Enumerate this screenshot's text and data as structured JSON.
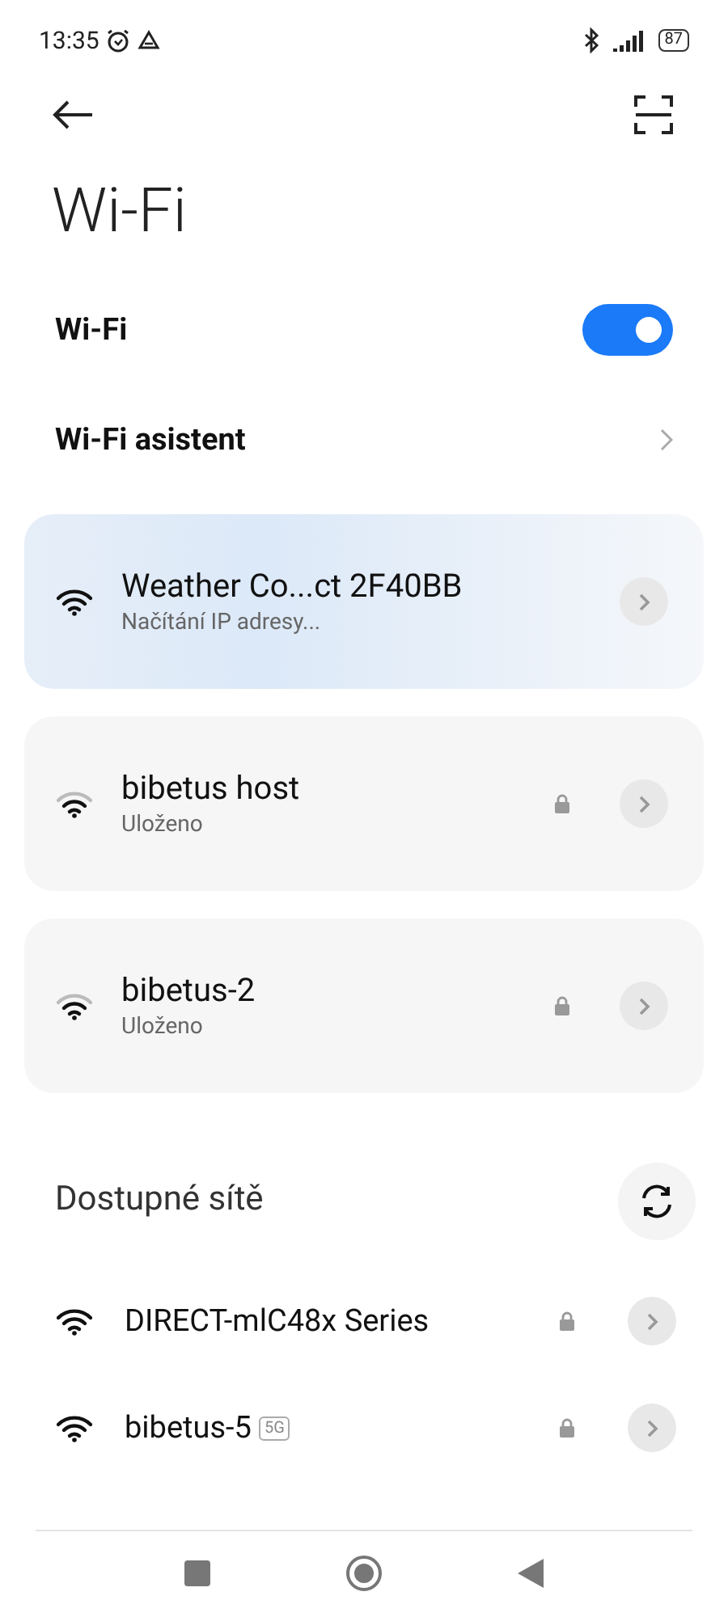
{
  "status_bar": {
    "time": "13:35",
    "battery": "87"
  },
  "title": "Wi-Fi",
  "wifi_toggle": {
    "label": "Wi-Fi",
    "on": true
  },
  "assistant": {
    "label": "Wi-Fi asistent"
  },
  "saved_networks": [
    {
      "name": "Weather Co...ct 2F40BB",
      "status": "Načítání IP adresy...",
      "active": true,
      "locked": false
    },
    {
      "name": "bibetus host",
      "status": "Uloženo",
      "active": false,
      "locked": true
    },
    {
      "name": "bibetus-2",
      "status": "Uloženo",
      "active": false,
      "locked": true
    }
  ],
  "available": {
    "heading": "Dostupné sítě",
    "networks": [
      {
        "name": "DIRECT-mlC48x Series",
        "locked": true
      },
      {
        "name": "bibetus-5",
        "band": "5G",
        "locked": true
      }
    ]
  }
}
